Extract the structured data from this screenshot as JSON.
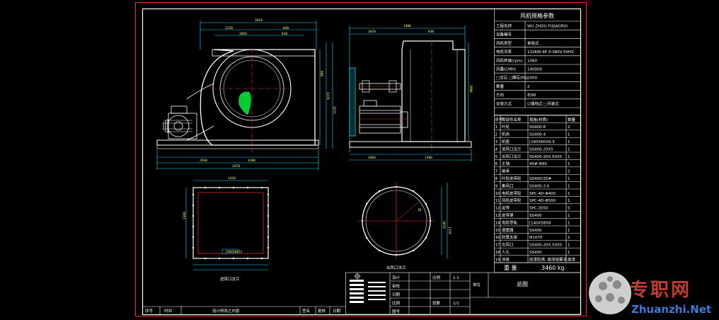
{
  "spec_table": {
    "title": "风机规格参数",
    "rows": [
      {
        "label": "工程名称",
        "value": "WU ZHOU FUJIAGRUI"
      },
      {
        "label": "设备编号",
        "value": ""
      },
      {
        "label": "风机类型",
        "value": "单吸式"
      },
      {
        "label": "电机功率",
        "value": "132KW-4P 3-380V-50HZ"
      },
      {
        "label": "风机转速(rpm)",
        "value": "1060"
      },
      {
        "label": "风量(CMH)",
        "value": "140000"
      },
      {
        "label": "□全压 □静压(Pa)",
        "value": "2000"
      },
      {
        "label": "数量",
        "value": "2"
      },
      {
        "label": "方向",
        "value": "右90"
      },
      {
        "label": "安装方式",
        "value": "☑落地式 □吊装式"
      }
    ]
  },
  "parts_table": {
    "headers": [
      "序号",
      "零部件名称",
      "规格(材质)",
      "数量"
    ],
    "rows": [
      [
        "1",
        "叶轮",
        "SS400-8",
        "2"
      ],
      [
        "2",
        "机壳",
        "SS400-4",
        "1"
      ],
      [
        "3",
        "机座",
        "[160X60X6.5",
        "1"
      ],
      [
        "4",
        "进风口法兰",
        "SS400-20X5",
        "1"
      ],
      [
        "5",
        "出风口法兰",
        "SS400-20X.50X5",
        "1"
      ],
      [
        "6",
        "主轴",
        "45#-Φ90",
        "1"
      ],
      [
        "7",
        "轴承",
        "",
        "2"
      ],
      [
        "8",
        "叶轮皮带轮",
        "SS400/25#",
        "1"
      ],
      [
        "9",
        "集风口",
        "SS400-3.0",
        "1"
      ],
      [
        "10",
        "电机皮带轮",
        "SPC-4D-Φ400",
        "1"
      ],
      [
        "11",
        "风机皮带轮",
        "SPC-4D-Φ500",
        "1"
      ],
      [
        "12",
        "皮带",
        "SPC-3550",
        "5"
      ],
      [
        "13",
        "皮带罩",
        "SS400",
        "1"
      ],
      [
        "14",
        "电机导轨",
        "[140X58X6",
        "1"
      ],
      [
        "15",
        "避震器",
        "SS400",
        "1"
      ],
      [
        "16",
        "防震支架",
        "Φ1070",
        "1"
      ],
      [
        "17",
        "出风口",
        "SS400-20X.50X5",
        "1"
      ],
      [
        "18",
        "人孔",
        "SS400",
        "1"
      ],
      [
        "19",
        "涂装",
        "底漆防锈, 面漆按要求",
        "面漆"
      ]
    ]
  },
  "weight": {
    "label": "重 量",
    "value": "3460 kg"
  },
  "title_block": {
    "labels": [
      "设计",
      "审核",
      "日期",
      "比例",
      "图号"
    ],
    "scale_label": "比例",
    "scale_value": "1:1",
    "sheet_label": "张数",
    "sheet_value": "1/1",
    "drawing_name": "总图",
    "unit_label": "单位",
    "bottom_labels": [
      "序号",
      "时间",
      "设计修改之内容",
      "签名",
      "复核",
      "日期"
    ]
  },
  "view_labels": {
    "inlet": "进风口法兰",
    "outlet": "出风口法兰"
  },
  "watermark": {
    "chinese": "专职网",
    "url": "Zhuanzhi.Net"
  },
  "colors": {
    "background": "#000000",
    "frame": "#ff2020",
    "outline": "#ffffff",
    "dimension": "#ffff00",
    "geometry": "#00e5ff",
    "centerline": "#ff3030",
    "motor": "#ffffff",
    "impeller": "#00cc33"
  }
}
